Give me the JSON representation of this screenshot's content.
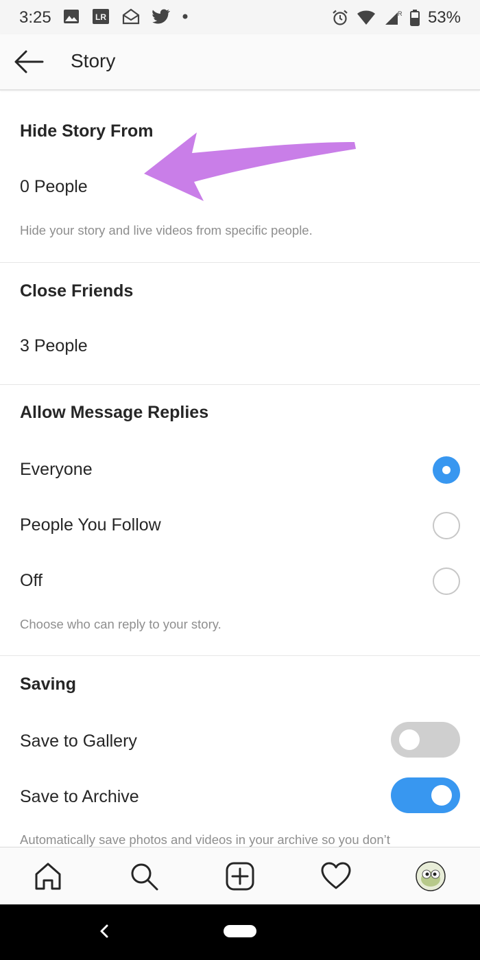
{
  "status_bar": {
    "time": "3:25",
    "battery": "53%",
    "icons": [
      "image-icon",
      "lightroom-icon",
      "mail-icon",
      "twitter-icon",
      "dot-icon",
      "alarm-icon",
      "wifi-icon",
      "signal-icon",
      "battery-icon"
    ]
  },
  "header": {
    "title": "Story",
    "back_icon": "back-arrow-icon"
  },
  "hide_story": {
    "title": "Hide Story From",
    "value": "0 People",
    "hint": "Hide your story and live videos from specific people."
  },
  "close_friends": {
    "title": "Close Friends",
    "value": "3 People"
  },
  "message_replies": {
    "title": "Allow Message Replies",
    "options": [
      {
        "label": "Everyone",
        "selected": true
      },
      {
        "label": "People You Follow",
        "selected": false
      },
      {
        "label": "Off",
        "selected": false
      }
    ],
    "hint": "Choose who can reply to your story."
  },
  "saving": {
    "title": "Saving",
    "items": [
      {
        "label": "Save to Gallery",
        "enabled": false
      },
      {
        "label": "Save to Archive",
        "enabled": true
      }
    ],
    "hint": "Automatically save photos and videos in your archive so you don’t"
  },
  "annotation": {
    "color": "#c97ee8"
  },
  "tab_bar": {
    "icons": [
      "home-icon",
      "search-icon",
      "add-post-icon",
      "heart-icon",
      "profile-avatar-icon"
    ]
  },
  "nav_bar": {
    "icons": [
      "nav-back-icon",
      "nav-home-pill-icon"
    ]
  },
  "colors": {
    "accent": "#3897f0",
    "toggle_off": "#cfcfcf",
    "text": "#262626",
    "hint": "#8e8e8e"
  }
}
